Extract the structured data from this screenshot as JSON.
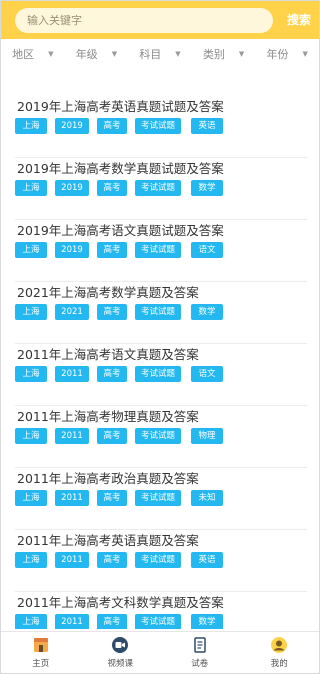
{
  "search": {
    "placeholder": "输入关键字",
    "button_label": "搜索"
  },
  "filters": [
    {
      "label": "地区"
    },
    {
      "label": "年级"
    },
    {
      "label": "科目"
    },
    {
      "label": "类别"
    },
    {
      "label": "年份"
    }
  ],
  "items": [
    {
      "title": "2019年上海高考英语真题试题及答案",
      "tags": [
        "上海",
        "2019",
        "高考",
        "考试试题",
        "英语"
      ]
    },
    {
      "title": "2019年上海高考数学真题试题及答案",
      "tags": [
        "上海",
        "2019",
        "高考",
        "考试试题",
        "数学"
      ]
    },
    {
      "title": "2019年上海高考语文真题试题及答案",
      "tags": [
        "上海",
        "2019",
        "高考",
        "考试试题",
        "语文"
      ]
    },
    {
      "title": "2021年上海高考数学真题及答案",
      "tags": [
        "上海",
        "2021",
        "高考",
        "考试试题",
        "数学"
      ]
    },
    {
      "title": "2011年上海高考语文真题及答案",
      "tags": [
        "上海",
        "2011",
        "高考",
        "考试试题",
        "语文"
      ]
    },
    {
      "title": "2011年上海高考物理真题及答案",
      "tags": [
        "上海",
        "2011",
        "高考",
        "考试试题",
        "物理"
      ]
    },
    {
      "title": "2011年上海高考政治真题及答案",
      "tags": [
        "上海",
        "2011",
        "高考",
        "考试试题",
        "未知"
      ]
    },
    {
      "title": "2011年上海高考英语真题及答案",
      "tags": [
        "上海",
        "2011",
        "高考",
        "考试试题",
        "英语"
      ]
    },
    {
      "title": "2011年上海高考文科数学真题及答案",
      "tags": [
        "上海",
        "2011",
        "高考",
        "考试试题",
        "数学"
      ]
    }
  ],
  "bottom_nav": [
    {
      "label": "主页",
      "icon": "home-icon"
    },
    {
      "label": "视频课",
      "icon": "video-icon"
    },
    {
      "label": "试卷",
      "icon": "paper-icon"
    },
    {
      "label": "我的",
      "icon": "profile-icon"
    }
  ],
  "colors": {
    "header": "#ffd24a",
    "tag": "#23b8f0"
  }
}
